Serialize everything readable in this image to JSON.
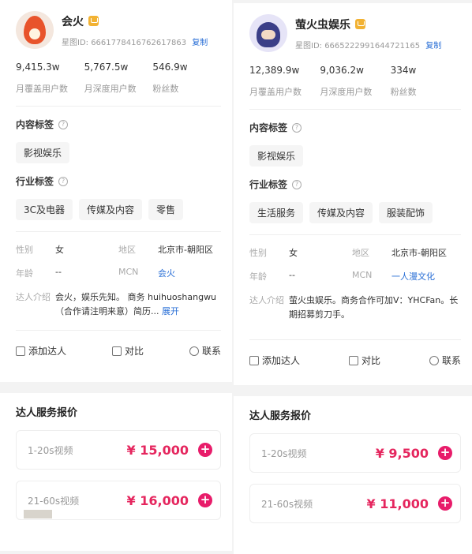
{
  "left": {
    "name": "会火",
    "id_text": "星图ID: 6661778416762617863",
    "copy_label": "复制",
    "stats": [
      {
        "value": "9,415.3w",
        "label": "月覆盖用户数"
      },
      {
        "value": "5,767.5w",
        "label": "月深度用户数"
      },
      {
        "value": "546.9w",
        "label": "粉丝数"
      }
    ],
    "content_tags_title": "内容标签",
    "content_tags": [
      "影视娱乐"
    ],
    "industry_tags_title": "行业标签",
    "industry_tags": [
      "3C及电器",
      "传媒及内容",
      "零售"
    ],
    "gender_label": "性别",
    "gender": "女",
    "region_label": "地区",
    "region": "北京市-朝阳区",
    "age_label": "年龄",
    "age": "--",
    "mcn_label": "MCN",
    "mcn": "会火",
    "intro_label": "达人介绍",
    "intro": "会火，娱乐先知。 商务 huihuoshangwu（合作请注明来意）简历...",
    "intro_more": "展开",
    "add_label": "添加达人",
    "compare_label": "对比",
    "contact_label": "联系",
    "price_title": "达人服务报价",
    "prices": [
      {
        "label": "1-20s视频",
        "value": "¥ 15,000"
      },
      {
        "label": "21-60s视频",
        "value": "¥ 16,000"
      }
    ]
  },
  "right": {
    "name": "萤火虫娱乐",
    "id_text": "星图ID: 6665222991644721165",
    "copy_label": "复制",
    "stats": [
      {
        "value": "12,389.9w",
        "label": "月覆盖用户数"
      },
      {
        "value": "9,036.2w",
        "label": "月深度用户数"
      },
      {
        "value": "334w",
        "label": "粉丝数"
      }
    ],
    "content_tags_title": "内容标签",
    "content_tags": [
      "影视娱乐"
    ],
    "industry_tags_title": "行业标签",
    "industry_tags": [
      "生活服务",
      "传媒及内容",
      "服装配饰"
    ],
    "gender_label": "性别",
    "gender": "女",
    "region_label": "地区",
    "region": "北京市-朝阳区",
    "age_label": "年龄",
    "age": "--",
    "mcn_label": "MCN",
    "mcn": "一人漫文化",
    "intro_label": "达人介绍",
    "intro": "萤火虫娱乐。商务合作可加V：YHCFan。长期招募剪刀手。",
    "add_label": "添加达人",
    "compare_label": "对比",
    "contact_label": "联系",
    "price_title": "达人服务报价",
    "prices": [
      {
        "label": "1-20s视频",
        "value": "¥ 9,500"
      },
      {
        "label": "21-60s视频",
        "value": "¥ 11,000"
      }
    ]
  }
}
